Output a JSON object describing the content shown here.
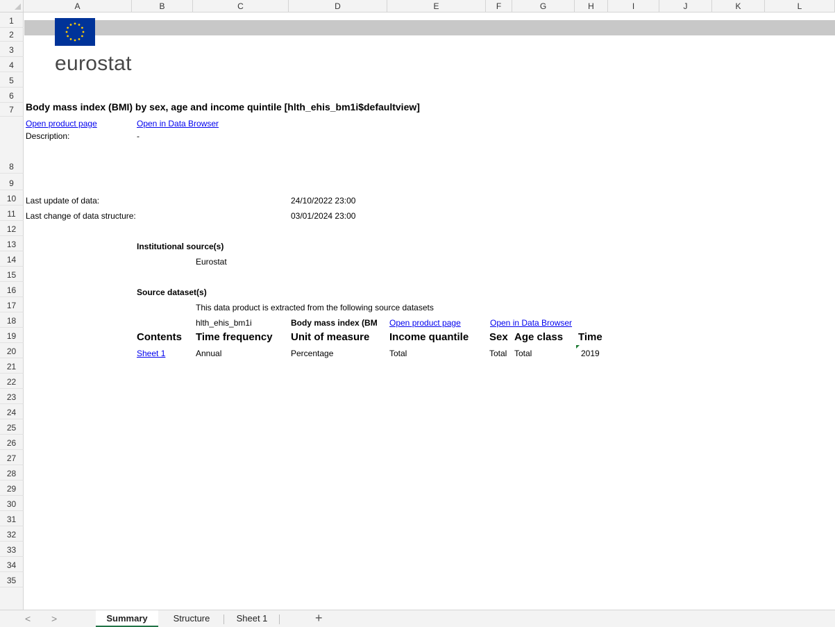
{
  "column_headers": [
    "A",
    "B",
    "C",
    "D",
    "E",
    "F",
    "G",
    "H",
    "I",
    "J",
    "K",
    "L"
  ],
  "row_headers": [
    "1",
    "2",
    "3",
    "4",
    "5",
    "6",
    "7",
    "8",
    "9",
    "10",
    "11",
    "12",
    "13",
    "14",
    "15",
    "16",
    "17",
    "18",
    "19",
    "20",
    "21",
    "22",
    "23",
    "24",
    "25",
    "26",
    "27",
    "28",
    "29",
    "30",
    "31",
    "32",
    "33",
    "34",
    "35"
  ],
  "logo": {
    "text": "eurostat",
    "flag": "eu-flag-icon"
  },
  "sheet": {
    "title": "Body mass index (BMI) by sex, age and income quintile [hlth_ehis_bm1i$defaultview]",
    "open_product_page": "Open product page",
    "open_data_browser": "Open in Data Browser",
    "description_label": "Description:",
    "description_value": "-",
    "last_update_label": "Last update of data:",
    "last_update_value": "24/10/2022 23:00",
    "last_change_label": "Last change of data structure:",
    "last_change_value": "03/01/2024 23:00",
    "institutional_label": "Institutional source(s)",
    "institutional_value": "Eurostat",
    "source_datasets_label": "Source dataset(s)",
    "source_datasets_intro": "This data product is extracted from the following source datasets",
    "dataset_code": "hlth_ehis_bm1i",
    "dataset_name": "Body mass index (BM",
    "dataset_open_product_page": "Open product page",
    "dataset_open_data_browser": "Open in Data Browser",
    "table_headers": {
      "contents": "Contents",
      "time_frequency": "Time frequency",
      "unit": "Unit of measure",
      "income": "Income quantile",
      "sex": "Sex",
      "age": "Age class",
      "time": "Time"
    },
    "table_row": {
      "contents": "Sheet 1",
      "time_frequency": "Annual",
      "unit": "Percentage",
      "income": "Total",
      "sex": "Total",
      "age": "Total",
      "time": "2019"
    }
  },
  "tabs": {
    "prev": "<",
    "next": ">",
    "items": [
      "Summary",
      "Structure",
      "Sheet 1"
    ],
    "active": "Summary",
    "add": "+"
  },
  "colors": {
    "link": "#0000ee",
    "header_bg": "#f3f3f3",
    "logo_bar": "#c8c8c8",
    "eu_blue": "#003399",
    "eu_gold": "#ffcc00",
    "active_tab_accent": "#217346"
  }
}
